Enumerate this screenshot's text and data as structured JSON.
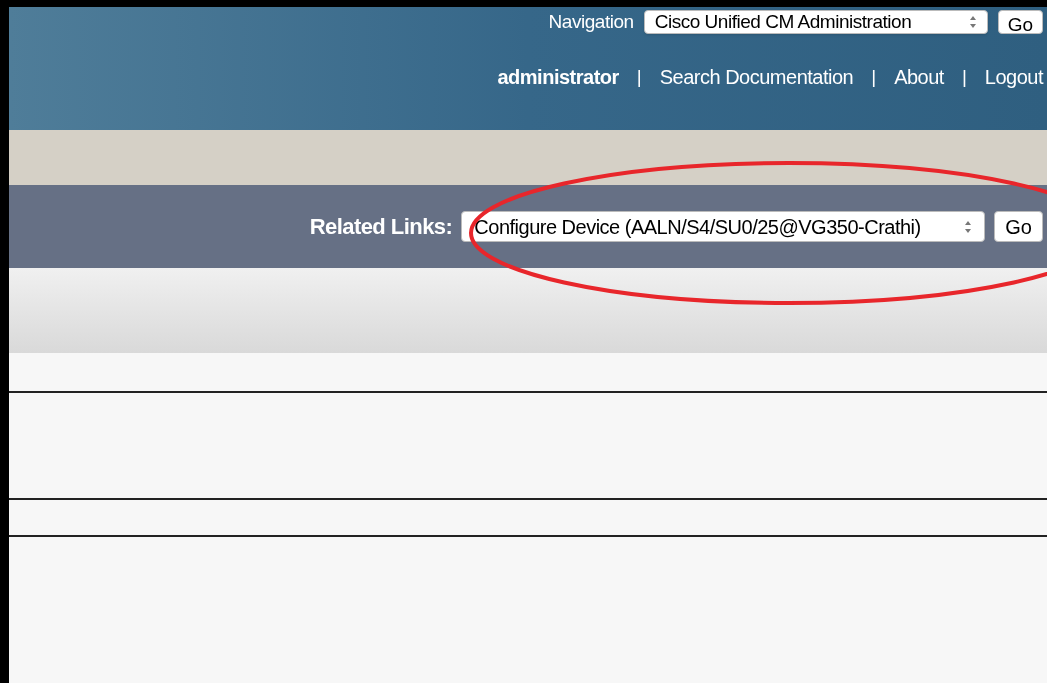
{
  "header": {
    "navigation_label": "Navigation",
    "navigation_select": "Cisco Unified CM Administration",
    "navigation_go": "Go",
    "user": "administrator",
    "separator": "|",
    "links": [
      "Search Documentation",
      "About",
      "Logout"
    ]
  },
  "related_links": {
    "label": "Related Links:",
    "select": "Configure Device (AALN/S4/SU0/25@VG350-Crathi)",
    "go": "Go"
  },
  "annotation": {
    "kind": "ellipse"
  }
}
